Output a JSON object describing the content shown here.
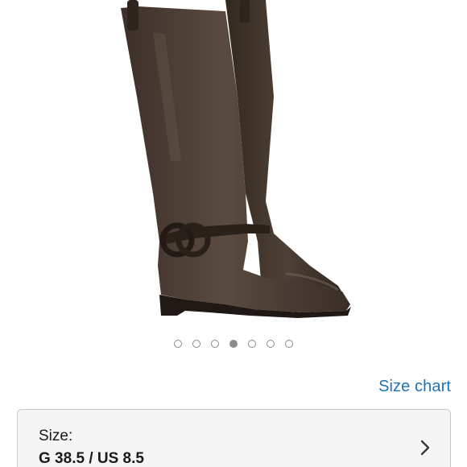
{
  "product": {
    "image_icon": "knee-high-brown-leather-boot-photo",
    "carousel": {
      "count": 7,
      "active_index": 3
    }
  },
  "links": {
    "size_chart_label": "Size chart"
  },
  "size_selector": {
    "label": "Size:",
    "value": "G 38.5 / US 8.5",
    "chevron_icon": "chevron-right-icon"
  },
  "colors": {
    "link": "#1f73b3",
    "boot_leather": "#4a3a30",
    "selector_bg": "#f5f5f5"
  }
}
